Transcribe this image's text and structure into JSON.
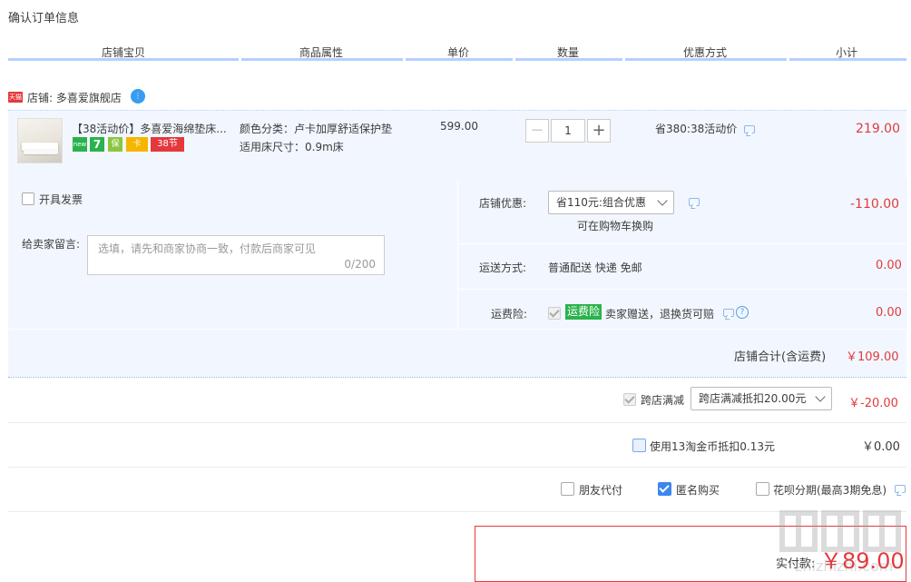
{
  "page_title": "确认订单信息",
  "columns": [
    "店铺宝贝",
    "商品属性",
    "单价",
    "数量",
    "优惠方式",
    "小计"
  ],
  "shop": {
    "badge": "天猫",
    "label": "店铺: 多喜爱旗舰店",
    "chat_icon": "wangwang-chat-icon"
  },
  "item": {
    "name": "【38活动价】多喜爱海绵垫床...",
    "attr_color": "颜色分类：卢卡加厚舒适保护垫",
    "attr_size": "适用床尺寸：0.9m床",
    "unit_price": "599.00",
    "quantity": "1",
    "discount": "省380:38活动价",
    "subtotal": "219.00",
    "tags": [
      "new",
      "7",
      "保",
      "卡",
      "38节"
    ]
  },
  "invoice_label": "开具发票",
  "message": {
    "label": "给卖家留言:",
    "placeholder": "选填，请先和商家协商一致，付款后商家可见",
    "counter": "0/200"
  },
  "shop_discount": {
    "label": "店铺优惠:",
    "selected": "省110元:组合优惠",
    "hint": "可在购物车换购",
    "amount": "-110.00"
  },
  "shipping": {
    "label": "运送方式:",
    "value": "普通配送 快递 免邮",
    "amount": "0.00"
  },
  "insurance": {
    "label": "运费险:",
    "badge": "运费险",
    "text": "卖家赠送，退换货可赔",
    "amount": "0.00"
  },
  "shop_total": {
    "label": "店铺合计(含运费)",
    "amount": "￥109.00"
  },
  "cross_store": {
    "label": "跨店满减",
    "selected": "跨店满减抵扣20.00元",
    "amount": "￥-20.00"
  },
  "coins": {
    "label": "使用13淘金币抵扣0.13元",
    "amount": "￥0.00"
  },
  "options": {
    "friend_pay": "朋友代付",
    "anonymous": "匿名购买",
    "huabei": "花呗分期(最高3期免息)"
  },
  "actual_pay": {
    "label": "实付款:",
    "amount": "￥89.00"
  },
  "watermark": "值|值|值 zhizhizhi.com",
  "colors": {
    "accent_red": "#e4393c",
    "blue_light": "#f2f7ff",
    "header_line": "#b2d1ff",
    "check_blue": "#3a87ef",
    "insurance_green": "#2bb24c"
  }
}
